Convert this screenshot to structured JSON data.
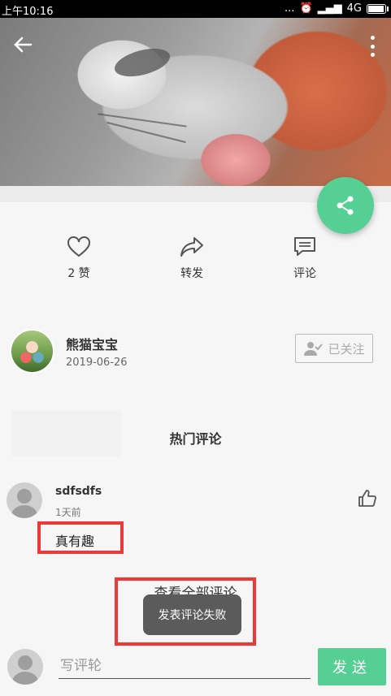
{
  "status_bar": {
    "time": "上午10:16",
    "dots": "...",
    "network": "4G"
  },
  "post_actions": {
    "like": {
      "label": "2 赞"
    },
    "forward": {
      "label": "转发"
    },
    "comment": {
      "label": "评论"
    }
  },
  "author": {
    "name": "熊猫宝宝",
    "date": "2019-06-26",
    "follow_label": "已关注"
  },
  "hot_comments": {
    "title": "热门评论",
    "items": [
      {
        "user": "sdfsdfs",
        "time": "1天前",
        "text": "真有趣"
      }
    ],
    "view_all_label": "查看全部评论"
  },
  "toast": {
    "message": "发表评论失败"
  },
  "comment_bar": {
    "placeholder": "写评轮",
    "send_label": "发送"
  },
  "colors": {
    "accent": "#56cf95",
    "highlight": "#ee3838"
  }
}
